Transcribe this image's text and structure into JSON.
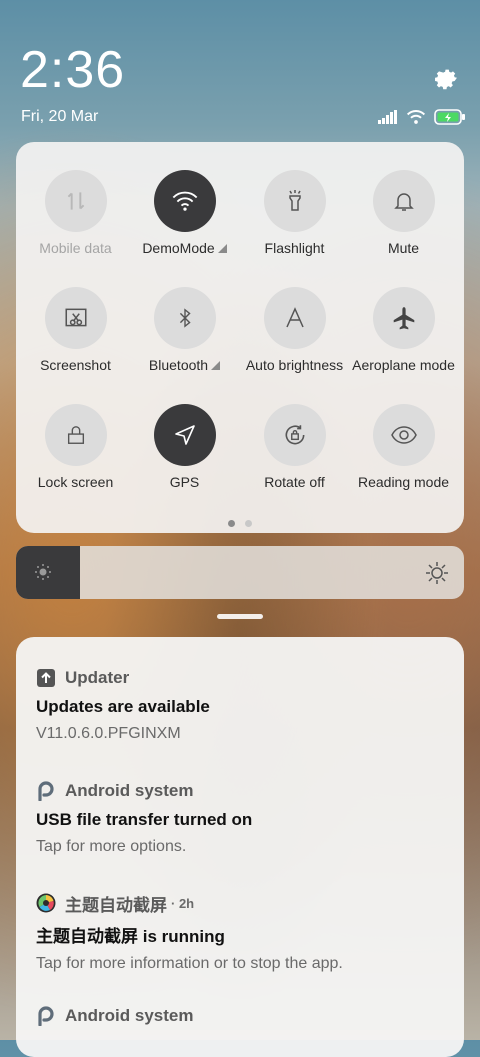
{
  "status": {
    "time": "2:36",
    "date": "Fri, 20 Mar"
  },
  "quick_settings": {
    "tiles": [
      {
        "label": "Mobile data",
        "state": "off-disabled",
        "icon": "mobile-data-icon"
      },
      {
        "label": "DemoMode",
        "state": "on",
        "icon": "wifi-icon",
        "has_expand": true
      },
      {
        "label": "Flashlight",
        "state": "off",
        "icon": "flashlight-icon"
      },
      {
        "label": "Mute",
        "state": "off",
        "icon": "bell-icon"
      },
      {
        "label": "Screenshot",
        "state": "off",
        "icon": "screenshot-icon"
      },
      {
        "label": "Bluetooth",
        "state": "off",
        "icon": "bluetooth-icon",
        "has_expand": true
      },
      {
        "label": "Auto brightness",
        "state": "off",
        "icon": "auto-brightness-icon"
      },
      {
        "label": "Aeroplane mode",
        "state": "off",
        "icon": "airplane-icon"
      },
      {
        "label": "Lock screen",
        "state": "off",
        "icon": "lock-icon"
      },
      {
        "label": "GPS",
        "state": "on",
        "icon": "gps-icon"
      },
      {
        "label": "Rotate off",
        "state": "off",
        "icon": "rotate-lock-icon"
      },
      {
        "label": "Reading mode",
        "state": "off",
        "icon": "eye-icon"
      }
    ],
    "page_count": 2,
    "current_page": 1
  },
  "brightness": {
    "level": 0.0
  },
  "notifications": [
    {
      "app": "Updater",
      "icon": "updater-icon",
      "time": "",
      "title": "Updates are available",
      "body": "V11.0.6.0.PFGINXM"
    },
    {
      "app": "Android system",
      "icon": "android-system-icon",
      "time": "",
      "title": "USB file transfer turned on",
      "body": "Tap for more options."
    },
    {
      "app": "主题自动截屏",
      "icon": "theme-screenshot-icon",
      "time": "· 2h",
      "title": "主题自动截屏 is running",
      "body": "Tap for more information or to stop the app."
    },
    {
      "app": "Android system",
      "icon": "android-system-icon",
      "time": "",
      "title": "",
      "body": ""
    }
  ],
  "colors": {
    "active_tile": "#3a3a3c",
    "inactive_tile": "#dcdcdc",
    "battery_green": "#4cd964"
  }
}
